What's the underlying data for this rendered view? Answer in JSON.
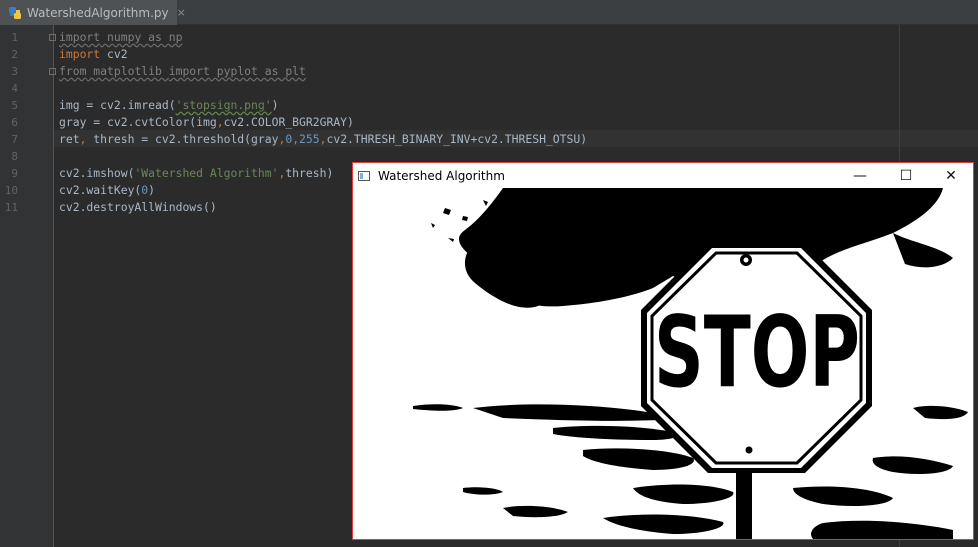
{
  "tab": {
    "filename": "WatershedAlgorithm.py",
    "close_glyph": "×"
  },
  "line_numbers": [
    "1",
    "2",
    "3",
    "4",
    "5",
    "6",
    "7",
    "8",
    "9",
    "10",
    "11"
  ],
  "code": {
    "l1": {
      "kw": "import",
      "rest": " numpy as np"
    },
    "l2": {
      "kw": "import",
      "rest": " cv2"
    },
    "l3": {
      "kw": "from",
      "mid": " matplotlib ",
      "kw2": "import",
      "rest": " pyplot as plt"
    },
    "l5": {
      "a": "img = cv2.imread(",
      "s": "'stopsign.png'",
      "b": ")"
    },
    "l6": {
      "a": "gray = cv2.cvtColor(img",
      "c": ",",
      "b": "cv2.COLOR_BGR2GRAY)"
    },
    "l7": {
      "a": "ret",
      "c1": ",",
      "b": " thresh = cv2.threshold(gray",
      "c2": ",",
      "n1": "0",
      "c3": ",",
      "n2": "255",
      "c4": ",",
      "d": "cv2.THRESH_BINARY_INV+cv2.THRESH_OTSU)"
    },
    "l9": {
      "a": "cv2.imshow(",
      "s": "'Watershed Algorithm'",
      "c": ",",
      "b": "thresh)"
    },
    "l10": {
      "a": "cv2.waitKey(",
      "n": "0",
      "b": ")"
    },
    "l11": {
      "a": "cv2.destroyAllWindows()"
    }
  },
  "window": {
    "title": "Watershed Algorithm",
    "minimize_glyph": "—",
    "maximize_glyph": "☐",
    "close_glyph": "✕",
    "image": {
      "sign_text": "STOP"
    }
  },
  "colors": {
    "editor_bg": "#2b2b2b",
    "keyword": "#cc7832",
    "string": "#6a8759",
    "number": "#6897bb",
    "window_border": "#e23b3b"
  }
}
